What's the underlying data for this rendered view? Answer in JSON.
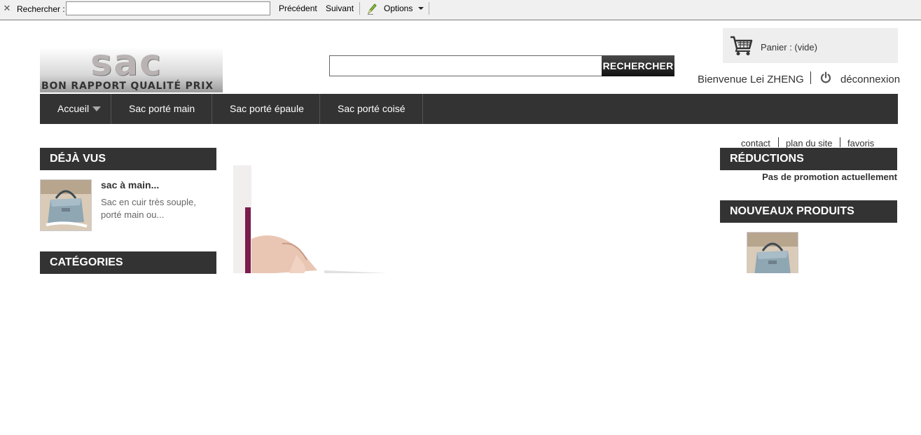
{
  "findbar": {
    "close_label": "✕",
    "search_label": "Rechercher :",
    "search_value": "",
    "prev_label": "Précédent",
    "next_label": "Suivant",
    "options_label": "Options"
  },
  "header": {
    "logo_word": "sac",
    "logo_slogan": "BON RAPPORT QUALITÉ PRIX",
    "search_value": "",
    "search_button": "RECHERCHER",
    "cart_label": "Panier : (vide)",
    "welcome": "Bienvenue Lei ZHENG",
    "logout": "déconnexion"
  },
  "nav": {
    "items": [
      {
        "label": "Accueil"
      },
      {
        "label": "Sac porté main"
      },
      {
        "label": "Sac porté épaule"
      },
      {
        "label": "Sac porté coisé"
      }
    ]
  },
  "toplinks": [
    "contact",
    "plan du site",
    "favoris"
  ],
  "left": {
    "viewed_title": "DÉJÀ VUS",
    "viewed_product": {
      "name": "sac à main...",
      "desc_line1": "Sac en cuir très souple,",
      "desc_line2": "porté main ou..."
    },
    "categories_title": "CATÉGORIES"
  },
  "right": {
    "reductions_title": "RÉDUCTIONS",
    "reductions_text": "Pas de promotion actuellement",
    "new_products_title": "NOUVEAUX PRODUITS"
  },
  "colors": {
    "dark_bar": "#333333",
    "cart_bg": "#eeeeee",
    "findbar_bg": "#f0f0f0"
  },
  "icons": [
    "close-icon",
    "pencil-icon",
    "chevron-down-icon",
    "cart-icon",
    "power-icon"
  ]
}
